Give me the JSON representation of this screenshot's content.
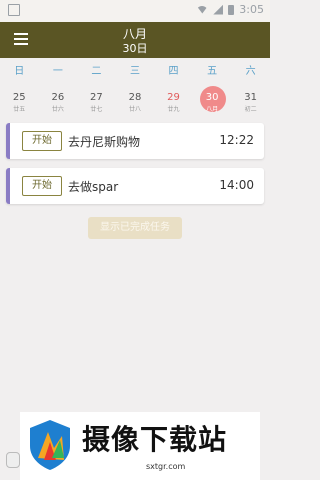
{
  "status_bar": {
    "time": "3:05"
  },
  "app_bar": {
    "month": "八月",
    "day": "30日"
  },
  "weekdays": [
    "日",
    "一",
    "二",
    "三",
    "四",
    "五",
    "六"
  ],
  "dates": [
    {
      "num": "25",
      "sub": "廿五"
    },
    {
      "num": "26",
      "sub": "廿六"
    },
    {
      "num": "27",
      "sub": "廿七"
    },
    {
      "num": "28",
      "sub": "廿八"
    },
    {
      "num": "29",
      "sub": "廿九"
    },
    {
      "num": "30",
      "sub": "八月"
    },
    {
      "num": "31",
      "sub": "初二"
    }
  ],
  "tasks": [
    {
      "action": "开始",
      "title": "去丹尼斯购物",
      "time": "12:22"
    },
    {
      "action": "开始",
      "title": "去做spar",
      "time": "14:00"
    }
  ],
  "show_done_label": "显示已完成任务",
  "watermark": {
    "title": "摄像下载站",
    "url": "sxtgr.com"
  },
  "colors": {
    "app_bar": "#5a5524",
    "today": "#f08a8a",
    "task_accent": "#8a7cc4"
  }
}
